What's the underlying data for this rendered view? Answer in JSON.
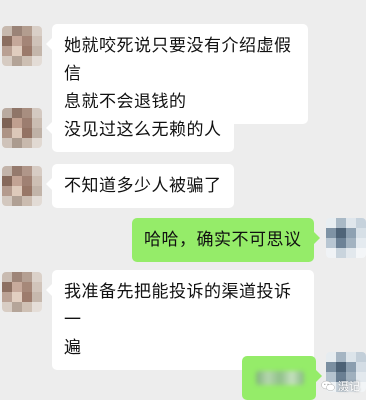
{
  "chat": {
    "messages": [
      {
        "side": "left",
        "lines": [
          "她就咬死说只要没有介绍虚假信",
          "息就不会退钱的"
        ]
      },
      {
        "side": "left",
        "lines": [
          "没见过这么无赖的人"
        ]
      },
      {
        "side": "left",
        "lines": [
          "不知道多少人被骗了"
        ]
      },
      {
        "side": "right",
        "lines": [
          "哈哈，确实不可思议"
        ]
      },
      {
        "side": "left",
        "lines": [
          "我准备先把能投诉的渠道投诉一",
          "遍"
        ]
      },
      {
        "side": "right",
        "lines": [
          ""
        ]
      }
    ]
  },
  "watermark": {
    "text": "滠记",
    "icon": "wechat-icon"
  },
  "colors": {
    "background": "#ededed",
    "incoming_bubble": "#ffffff",
    "outgoing_bubble": "#95ec69"
  }
}
